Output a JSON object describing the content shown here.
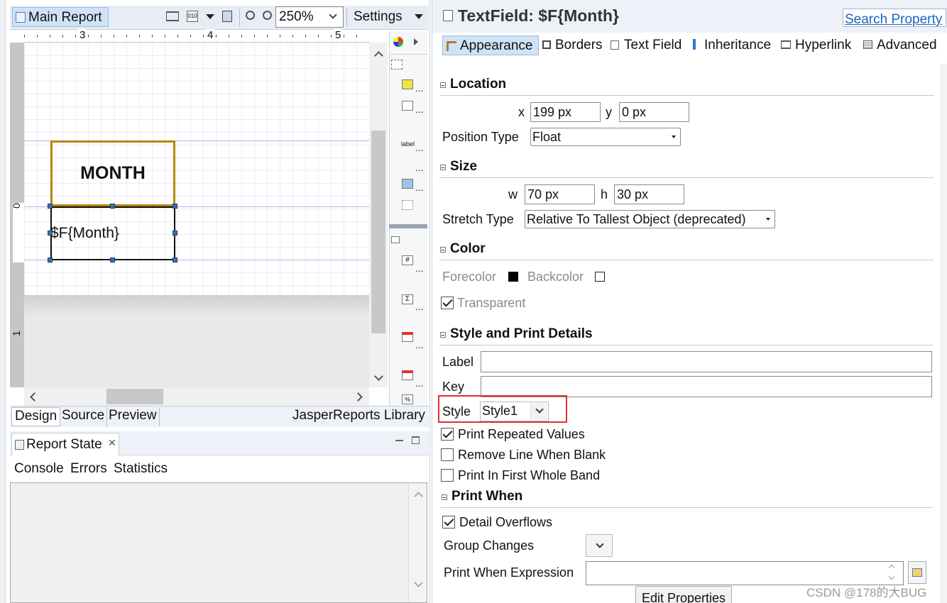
{
  "editor": {
    "tab_title": "Main Report",
    "zoom": "250%",
    "settings_label": "Settings",
    "ruler_numbers": [
      "3",
      "4",
      "5"
    ],
    "vruler_labels": [
      "0",
      "1"
    ],
    "column_header_text": "MONTH",
    "field_text": "$F{Month}",
    "bottom_tabs": [
      "Design",
      "Source",
      "Preview"
    ],
    "library_label": "JasperReports Library"
  },
  "report_state": {
    "title": "Report State",
    "tabs": [
      "Console",
      "Errors",
      "Statistics"
    ]
  },
  "palette": {
    "label_item": "label",
    "dots": "..."
  },
  "properties": {
    "title": "TextField: $F{Month}",
    "search_label": "Search Property",
    "tabs": [
      "Appearance",
      "Borders",
      "Text Field",
      "Inheritance",
      "Hyperlink",
      "Advanced"
    ],
    "location": {
      "heading": "Location",
      "x_label": "x",
      "x_value": "199 px",
      "y_label": "y",
      "y_value": "0 px",
      "position_type_label": "Position Type",
      "position_type_value": "Float"
    },
    "size": {
      "heading": "Size",
      "w_label": "w",
      "w_value": "70 px",
      "h_label": "h",
      "h_value": "30 px",
      "stretch_type_label": "Stretch Type",
      "stretch_type_value": "Relative To Tallest Object (deprecated)"
    },
    "color": {
      "heading": "Color",
      "forecolor_label": "Forecolor",
      "forecolor": "#000000",
      "backcolor_label": "Backcolor",
      "backcolor": "#ffffff",
      "transparent_label": "Transparent"
    },
    "style_print": {
      "heading": "Style and Print Details",
      "label_label": "Label",
      "label_value": "",
      "key_label": "Key",
      "key_value": "",
      "style_label": "Style",
      "style_value": "Style1",
      "print_repeated_label": "Print Repeated Values",
      "remove_line_label": "Remove Line When Blank",
      "print_first_band_label": "Print In First Whole Band"
    },
    "print_when": {
      "heading": "Print When",
      "detail_overflows_label": "Detail Overflows",
      "group_changes_label": "Group Changes",
      "expression_label": "Print When Expression",
      "expression_value": "",
      "edit_properties_label": "Edit Properties"
    }
  },
  "watermark": "CSDN @178的大BUG",
  "colors": {
    "highlight_red": "#e03030",
    "selection_gold": "#b8860b",
    "tab_active_bg": "#cfe3f7",
    "link_blue": "#1a66c2",
    "disabled_text": "#8a8a8a"
  }
}
